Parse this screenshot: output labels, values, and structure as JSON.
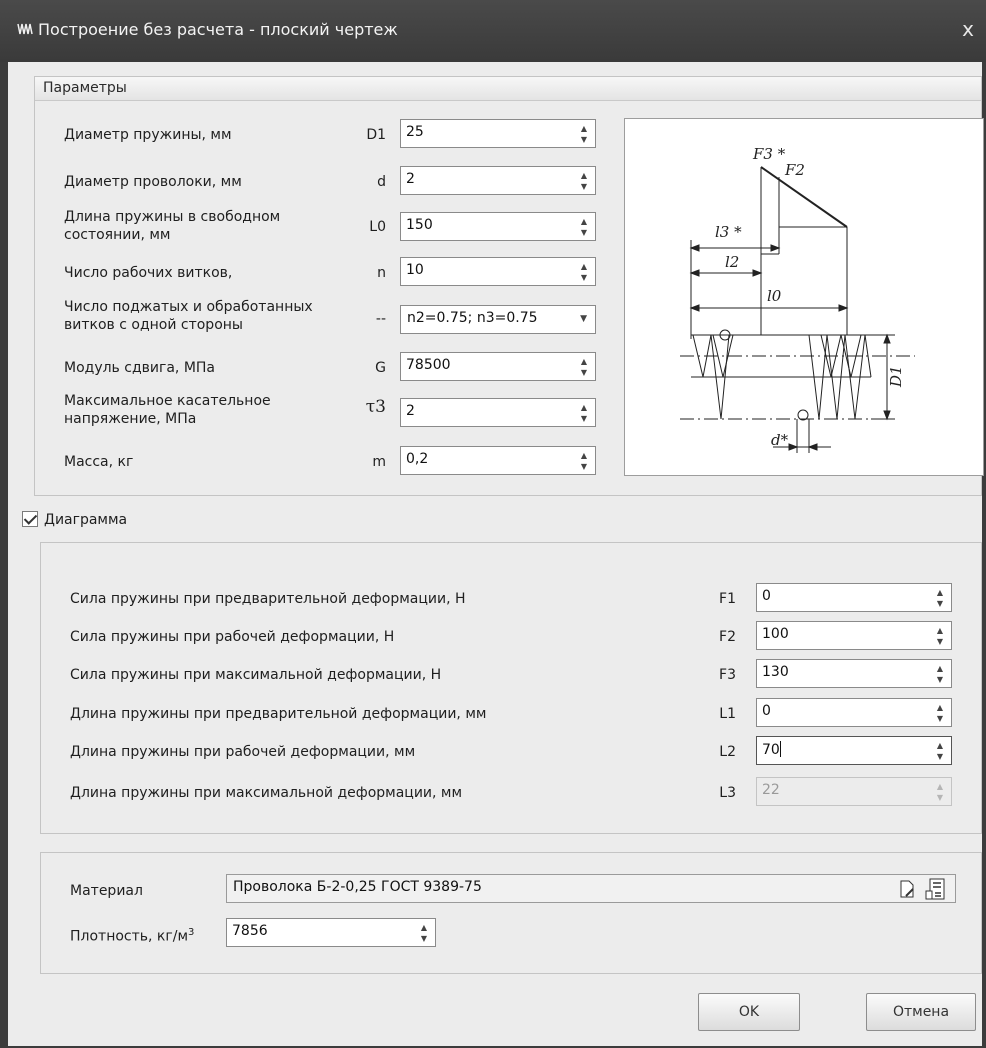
{
  "window": {
    "title": "Построение без расчета - плоский чертеж",
    "close_glyph": "x"
  },
  "params_group": {
    "title": "Параметры",
    "rows": [
      {
        "label": "Диаметр пружины, мм",
        "symbol": "D1",
        "value": "25"
      },
      {
        "label": "Диаметр проволоки, мм",
        "symbol": "d",
        "value": "2"
      },
      {
        "label": "Длина пружины в свободном\nсостоянии, мм",
        "symbol": "L0",
        "value": "150"
      },
      {
        "label": "Число рабочих витков,",
        "symbol": "n",
        "value": "10"
      },
      {
        "label": "Число поджатых и обработанных\nвитков с одной стороны",
        "symbol": "--",
        "value": "n2=0.75; n3=0.75"
      },
      {
        "label": "Модуль сдвига, МПа",
        "symbol": "G",
        "value": "78500"
      },
      {
        "label": "Максимальное касательное\nнапряжение,  МПа",
        "symbol": "τ3",
        "value": "2"
      },
      {
        "label": "Масса, кг",
        "symbol": "m",
        "value": "0,2"
      }
    ]
  },
  "drawing_labels": {
    "f3": "F3 *",
    "f2": "F2",
    "l3": "l3 *",
    "l2": "l2",
    "l0": "l0",
    "d1": "D1",
    "d": "d*"
  },
  "diagram": {
    "checkbox_label": "Диаграмма",
    "checked": true,
    "rows": [
      {
        "label": "Сила пружины при предварительной деформации, Н",
        "symbol": "F1",
        "value": "0",
        "disabled": false
      },
      {
        "label": "Сила пружины при рабочей деформации, Н",
        "symbol": "F2",
        "value": "100",
        "disabled": false
      },
      {
        "label": "Сила пружины при максимальной деформации, Н",
        "symbol": "F3",
        "value": "130",
        "disabled": false
      },
      {
        "label": "Длина пружины при предварительной деформации, мм",
        "symbol": "L1",
        "value": "0",
        "disabled": false
      },
      {
        "label": "Длина пружины при рабочей деформации, мм",
        "symbol": "L2",
        "value": "70",
        "disabled": false
      },
      {
        "label": "Длина пружины при максимальной деформации, мм",
        "symbol": "L3",
        "value": "22",
        "disabled": true
      }
    ]
  },
  "material": {
    "label": "Материал",
    "value": "Проволока Б-2-0,25 ГОСТ 9389-75",
    "density_label": "Плотность, кг/м",
    "density_sup": "3",
    "density_value": "7856"
  },
  "buttons": {
    "ok": "OK",
    "cancel": "Отмена"
  }
}
